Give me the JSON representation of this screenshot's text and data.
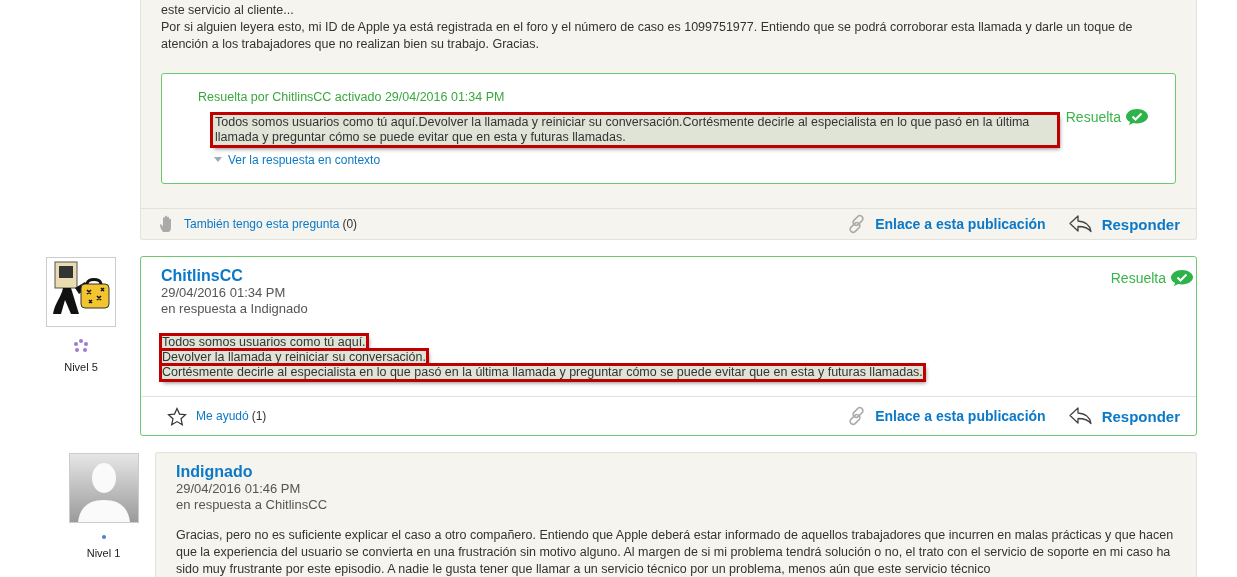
{
  "posts": [
    {
      "kind": "tail",
      "paragraphs": [
        "este servicio al cliente...",
        "Por si alguien leyera esto, mi ID de Apple ya está registrada en el foro y el número de caso es 1099751977. Entiendo que se podrá corroborar esta llamada y darle un toque de atención a los trabajadores que no realizan bien su trabajo. Gracias."
      ],
      "correct_answer": {
        "header": "Resuelta por ChitlinsCC activado 29/04/2016 01:34 PM",
        "badge": "Resuelta",
        "text": "Todos somos usuarios como tú aquí.Devolver la llamada y reiniciar su conversación.Cortésmente decirle al especialista en lo que pasó en la última llamada y preguntar cómo se puede evitar que en esta y futuras llamadas.",
        "highlighted": true,
        "link": "Ver la respuesta en contexto"
      },
      "footer": {
        "vote_label": "También tengo esta pregunta",
        "vote_count": "(0)",
        "link": "Enlace a esta publicación",
        "reply": "Responder"
      }
    },
    {
      "kind": "answer",
      "author": "ChitlinsCC",
      "date": "29/04/2016 01:34 PM",
      "in_reply_to": "en respuesta a Indignado",
      "level": "Nivel 5",
      "badge": "Resuelta",
      "lines": [
        {
          "text": "Todos somos usuarios como tú aquí.",
          "highlighted": true
        },
        {
          "text": "Devolver la llamada y reiniciar su conversación.",
          "highlighted": true
        },
        {
          "text": "Cortésmente decirle al especialista en lo que pasó en la última llamada y preguntar cómo se puede evitar que en esta y futuras llamadas.",
          "highlighted": true
        }
      ],
      "footer": {
        "vote_label": "Me ayudó",
        "vote_count": "(1)",
        "link": "Enlace a esta publicación",
        "reply": "Responder"
      }
    },
    {
      "kind": "reply",
      "author": "Indignado",
      "date": "29/04/2016 01:46 PM",
      "in_reply_to": "en respuesta a ChitlinsCC",
      "level": "Nivel 1",
      "paragraphs": [
        "Gracias, pero no es suficiente explicar el caso a otro compañero. Entiendo que Apple deberá estar informado de aquellos trabajadores que incurren en malas prácticas y que hacen que la experiencia del usuario se convierta en una frustración sin motivo alguno. Al margen de si mi problema tendrá solución o no, el trato con el servicio de soporte en mi caso ha sido muy frustrante por este episodio. A nadie le gusta tener que llamar a un servicio técnico por un problema, menos aún que este servicio técnico"
      ]
    }
  ]
}
